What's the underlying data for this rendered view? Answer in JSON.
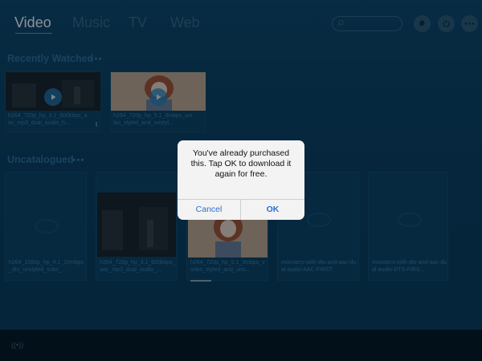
{
  "nav": {
    "tabs": [
      {
        "label": "Video"
      },
      {
        "label": "Music"
      },
      {
        "label": "TV"
      },
      {
        "label": "Web"
      }
    ],
    "active_tab": "Video",
    "search_placeholder": ""
  },
  "header_icons": [
    "puzzle-icon",
    "power-icon",
    "more-icon"
  ],
  "sections": {
    "recently_watched": {
      "title": "Recently Watched",
      "more": "•••",
      "items": [
        {
          "title": "h264_720p_hp_3.1_600kbps_aac_mp3_dual_audio_h...",
          "thumb": "dark"
        },
        {
          "title": "h264_720p_hp_5.1_3mbps_vorbis_styled_and_unstyl...",
          "thumb": "anime"
        }
      ]
    },
    "uncatalogued": {
      "title": "Uncatalogued",
      "more": "•••",
      "items": [
        {
          "title": "h264_1080p_hp_4.1_10mbps_dts_unstyled_subs_...",
          "thumb": "placeholder"
        },
        {
          "title": "h264_720p_hp_3.1_600kbps_aac_mp3_dual_audio_...",
          "thumb": "dark"
        },
        {
          "title": "h264_720p_hp_5.1_3mbps_vorbis_styled_and_uns...",
          "thumb": "anime"
        },
        {
          "title": "monsters-with-dts-and-aac-dual-audio-AAC-FIRST",
          "thumb": "placeholder"
        },
        {
          "title": "monsters-with-dts-and-aac-dual-audio-DTS-FIRS...",
          "thumb": "placeholder"
        }
      ]
    }
  },
  "alert": {
    "message": "You've already purchased this. Tap OK to download it again for free.",
    "cancel_label": "Cancel",
    "ok_label": "OK"
  },
  "footer": {
    "airplay_label": "((•))"
  },
  "colors": {
    "background": "#0b3a58",
    "accent": "#2f6f9a",
    "alert_button": "#2b6fd0"
  }
}
